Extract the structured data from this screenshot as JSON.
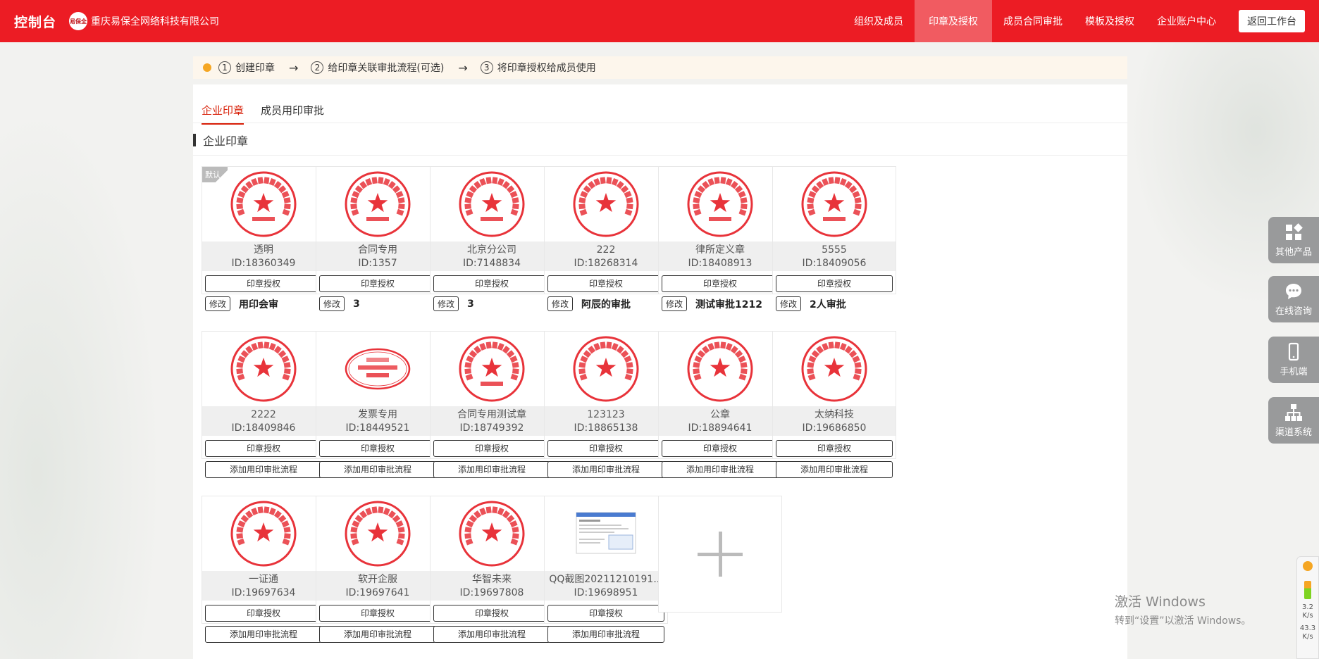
{
  "header": {
    "brand": "控制台",
    "company_logo": "易保全",
    "company_name": "重庆易保全网络科技有限公司",
    "nav": [
      {
        "label": "组织及成员",
        "active": false
      },
      {
        "label": "印章及授权",
        "active": true
      },
      {
        "label": "成员合同审批",
        "active": false
      },
      {
        "label": "模板及授权",
        "active": false
      },
      {
        "label": "企业账户中心",
        "active": false
      }
    ],
    "return_label": "返回工作台"
  },
  "steps": [
    {
      "num": "1",
      "label": "创建印章"
    },
    {
      "num": "2",
      "label": "给印章关联审批流程(可选)"
    },
    {
      "num": "3",
      "label": "将印章授权给成员使用"
    }
  ],
  "tabs": [
    {
      "label": "企业印章",
      "active": true
    },
    {
      "label": "成员用印审批",
      "active": false
    }
  ],
  "section_title": "企业印章",
  "seal_buttons": {
    "auth": "印章授权",
    "flow": "添加用印审批流程",
    "edit": "修改"
  },
  "default_badge": "默认",
  "seals": [
    {
      "name": "透明",
      "id": "ID:18360349",
      "seal_text": "重庆易保全网络科技有限公司",
      "sub": "演示用章",
      "default": true,
      "flow": "用印会审"
    },
    {
      "name": "合同专用",
      "id": "ID:1357",
      "seal_text": "重庆易保全网络科技有限公司",
      "sub": "合同专用",
      "flow": "3"
    },
    {
      "name": "北京分公司",
      "id": "ID:7148834",
      "seal_text": "重庆易保全网络科技有限公司",
      "sub": "北京分公司",
      "flow": "3"
    },
    {
      "name": "222",
      "id": "ID:18268314",
      "seal_text": "重庆易保全网络科技有限公司",
      "sub": "",
      "flow": "阿辰的审批"
    },
    {
      "name": "律所定义章",
      "id": "ID:18408913",
      "seal_text": "北京市律所企业管理有限公司",
      "sub": "合同专用章",
      "flow": "测试审批1212"
    },
    {
      "name": "5555",
      "id": "ID:18409056",
      "seal_text": "北京某某科技有限公司",
      "sub": "合同专用章",
      "flow": "2人审批"
    },
    {
      "name": "2222",
      "id": "ID:18409846",
      "seal_text": "重庆运通网络技术有限公司",
      "sub": ""
    },
    {
      "name": "发票专用",
      "id": "ID:18449521",
      "seal_text": "重庆易保全",
      "sub": "发票专用",
      "oval": true
    },
    {
      "name": "合同专用测试章",
      "id": "ID:18749392",
      "seal_text": "重庆易保全网络科技有限公司",
      "sub": "合同专用"
    },
    {
      "name": "123123",
      "id": "ID:18865138",
      "seal_text": "1 2 3 1 3 1 2 3",
      "sub": ""
    },
    {
      "name": "公章",
      "id": "ID:18894641",
      "seal_text": "重庆易保全网络科技有限公司",
      "sub": ""
    },
    {
      "name": "太纳科技",
      "id": "ID:19686850",
      "seal_text": "重庆太纳科技有限公司",
      "sub": ""
    },
    {
      "name": "一证通",
      "id": "ID:19697634",
      "seal_text": "重庆一证通信息技术有限公司",
      "sub": ""
    },
    {
      "name": "软开企服",
      "id": "ID:19697641",
      "seal_text": "重庆软开企业服务有限公司",
      "sub": ""
    },
    {
      "name": "华智未来",
      "id": "ID:19697808",
      "seal_text": "华智未来（重庆）科技有限公司",
      "sub": ""
    },
    {
      "name": "QQ截图20211210191...",
      "id": "ID:19698951",
      "screenshot": true
    }
  ],
  "sidebar": [
    {
      "label": "其他产品",
      "icon": "apps-icon"
    },
    {
      "label": "在线咨询",
      "icon": "chat-icon"
    },
    {
      "label": "手机端",
      "icon": "mobile-icon"
    },
    {
      "label": "渠道系统",
      "icon": "network-icon"
    }
  ],
  "watermark": {
    "line1": "激活 Windows",
    "line2": "转到“设置”以激活 Windows。"
  },
  "tray": {
    "up": "3.2",
    "up_unit": "K/s",
    "down": "43.3",
    "down_unit": "K/s"
  },
  "colors": {
    "header": "#ec1c24",
    "seal": "#e8333a",
    "tab_active": "#d81e06"
  }
}
